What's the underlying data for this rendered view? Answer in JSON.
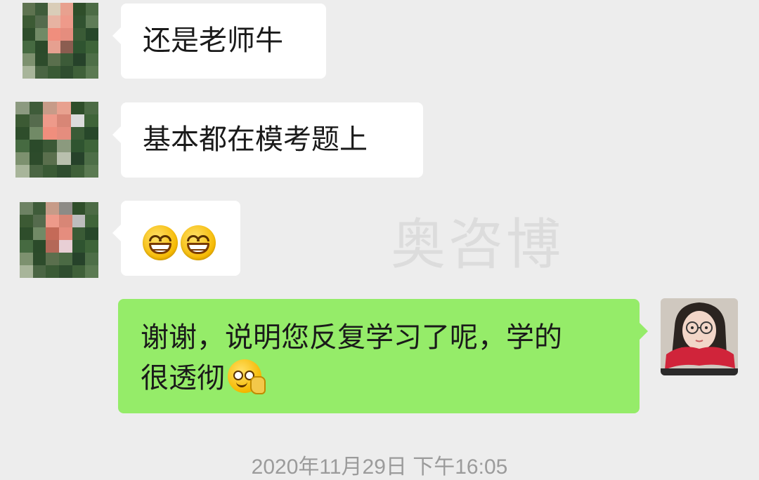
{
  "chat": {
    "messages": [
      {
        "from": "other",
        "text": "还是老师牛"
      },
      {
        "from": "other",
        "text": "基本都在模考题上"
      },
      {
        "from": "other",
        "text": "",
        "emojis": [
          "grinning-emoji",
          "grinning-emoji"
        ]
      },
      {
        "from": "self",
        "text_line1": "谢谢，说明您反复学习了呢，学的",
        "text_line2": "很透彻",
        "emoji": "smirk-emoji"
      }
    ],
    "timestamp": "2020年11月29日 下午16:05"
  },
  "watermark": "奥咨博",
  "colors": {
    "background": "#ededed",
    "incoming_bubble": "#ffffff",
    "outgoing_bubble": "#95ec69",
    "timestamp": "#9b9b9b"
  }
}
